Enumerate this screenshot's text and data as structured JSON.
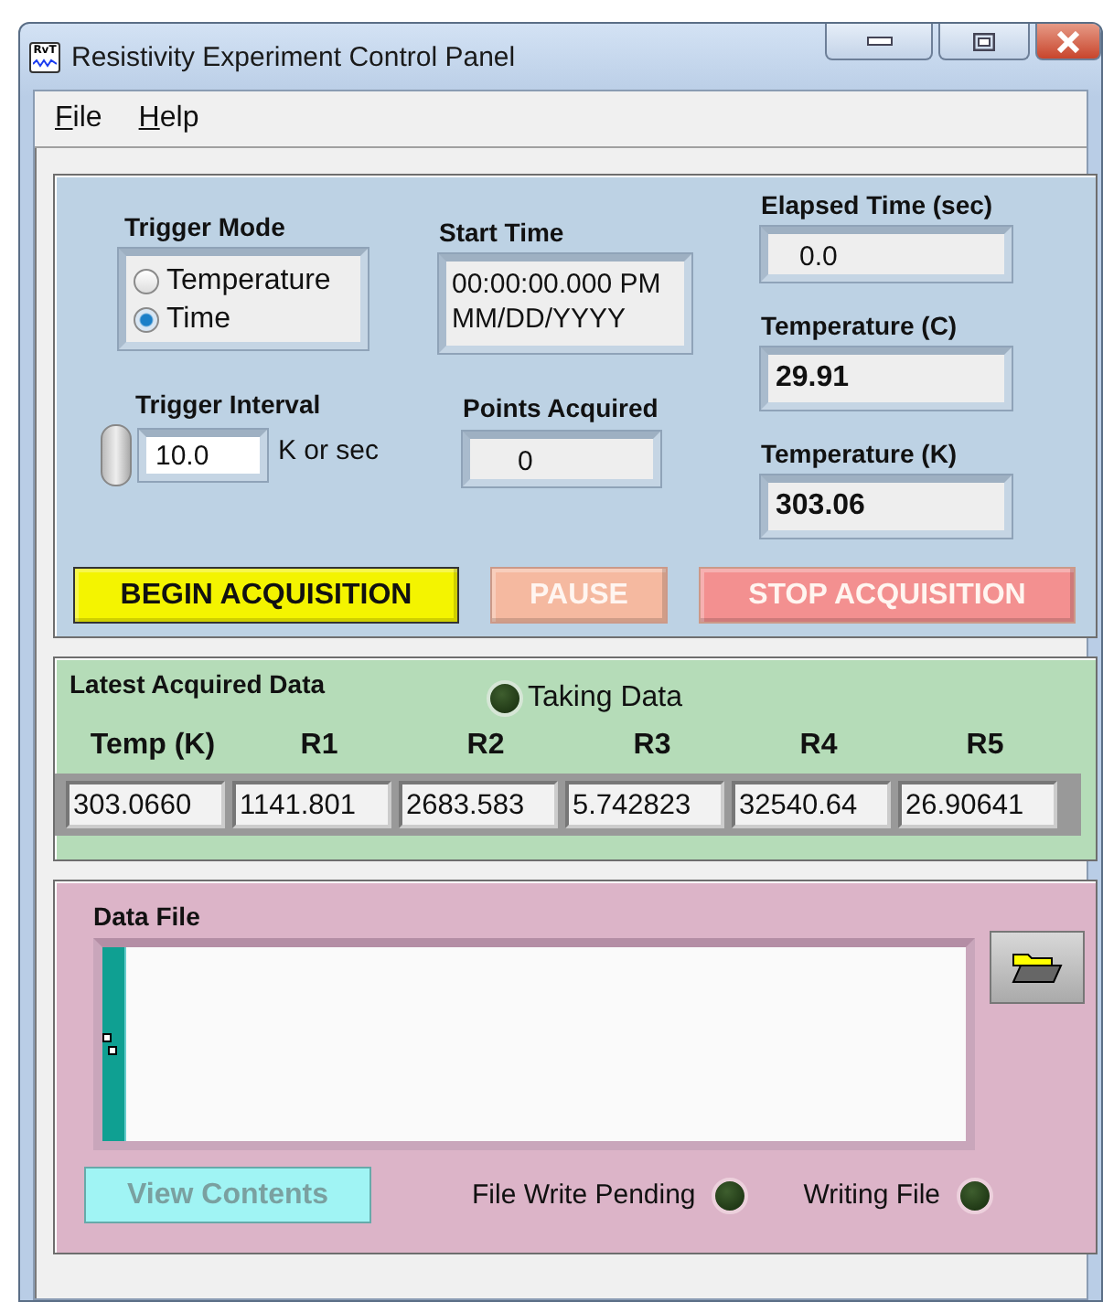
{
  "window": {
    "title": "Resistivity Experiment Control Panel",
    "icon_text": "RvT"
  },
  "menu": [
    {
      "label": "File"
    },
    {
      "label": "Help"
    }
  ],
  "controls": {
    "trigger_mode": {
      "label": "Trigger Mode",
      "options": [
        {
          "label": "Temperature",
          "selected": false
        },
        {
          "label": "Time",
          "selected": true
        }
      ]
    },
    "start_time": {
      "label": "Start Time",
      "lines": [
        "00:00:00.000 PM",
        "MM/DD/YYYY"
      ]
    },
    "trigger_interval": {
      "label": "Trigger Interval",
      "value": "10.0",
      "unit": "K or sec"
    },
    "points_acquired": {
      "label": "Points Acquired",
      "value": "0"
    },
    "readouts": [
      {
        "label": "Elapsed Time (sec)",
        "value": "0.0",
        "bold": false
      },
      {
        "label": "Temperature (C)",
        "value": "29.91",
        "bold": true
      },
      {
        "label": "Temperature (K)",
        "value": "303.06",
        "bold": true
      }
    ],
    "buttons": [
      {
        "label": "BEGIN ACQUISITION",
        "kind": "begin",
        "disabled": false
      },
      {
        "label": "PAUSE",
        "kind": "pause",
        "disabled": true
      },
      {
        "label": "STOP ACQUISITION",
        "kind": "stop",
        "disabled": true
      }
    ]
  },
  "latest_data": {
    "title": "Latest Acquired Data",
    "indicator": {
      "label": "Taking Data",
      "on": false
    },
    "columns": [
      "Temp (K)",
      "R1",
      "R2",
      "R3",
      "R4",
      "R5"
    ],
    "values": [
      "303.0660",
      "1141.801",
      "2683.583",
      "5.742823",
      "32540.64",
      "26.90641"
    ]
  },
  "data_file": {
    "label": "Data File",
    "view_button": {
      "label": "View Contents",
      "disabled": true
    },
    "indicators": [
      {
        "label": "File Write Pending",
        "on": false
      },
      {
        "label": "Writing File",
        "on": false
      }
    ]
  }
}
